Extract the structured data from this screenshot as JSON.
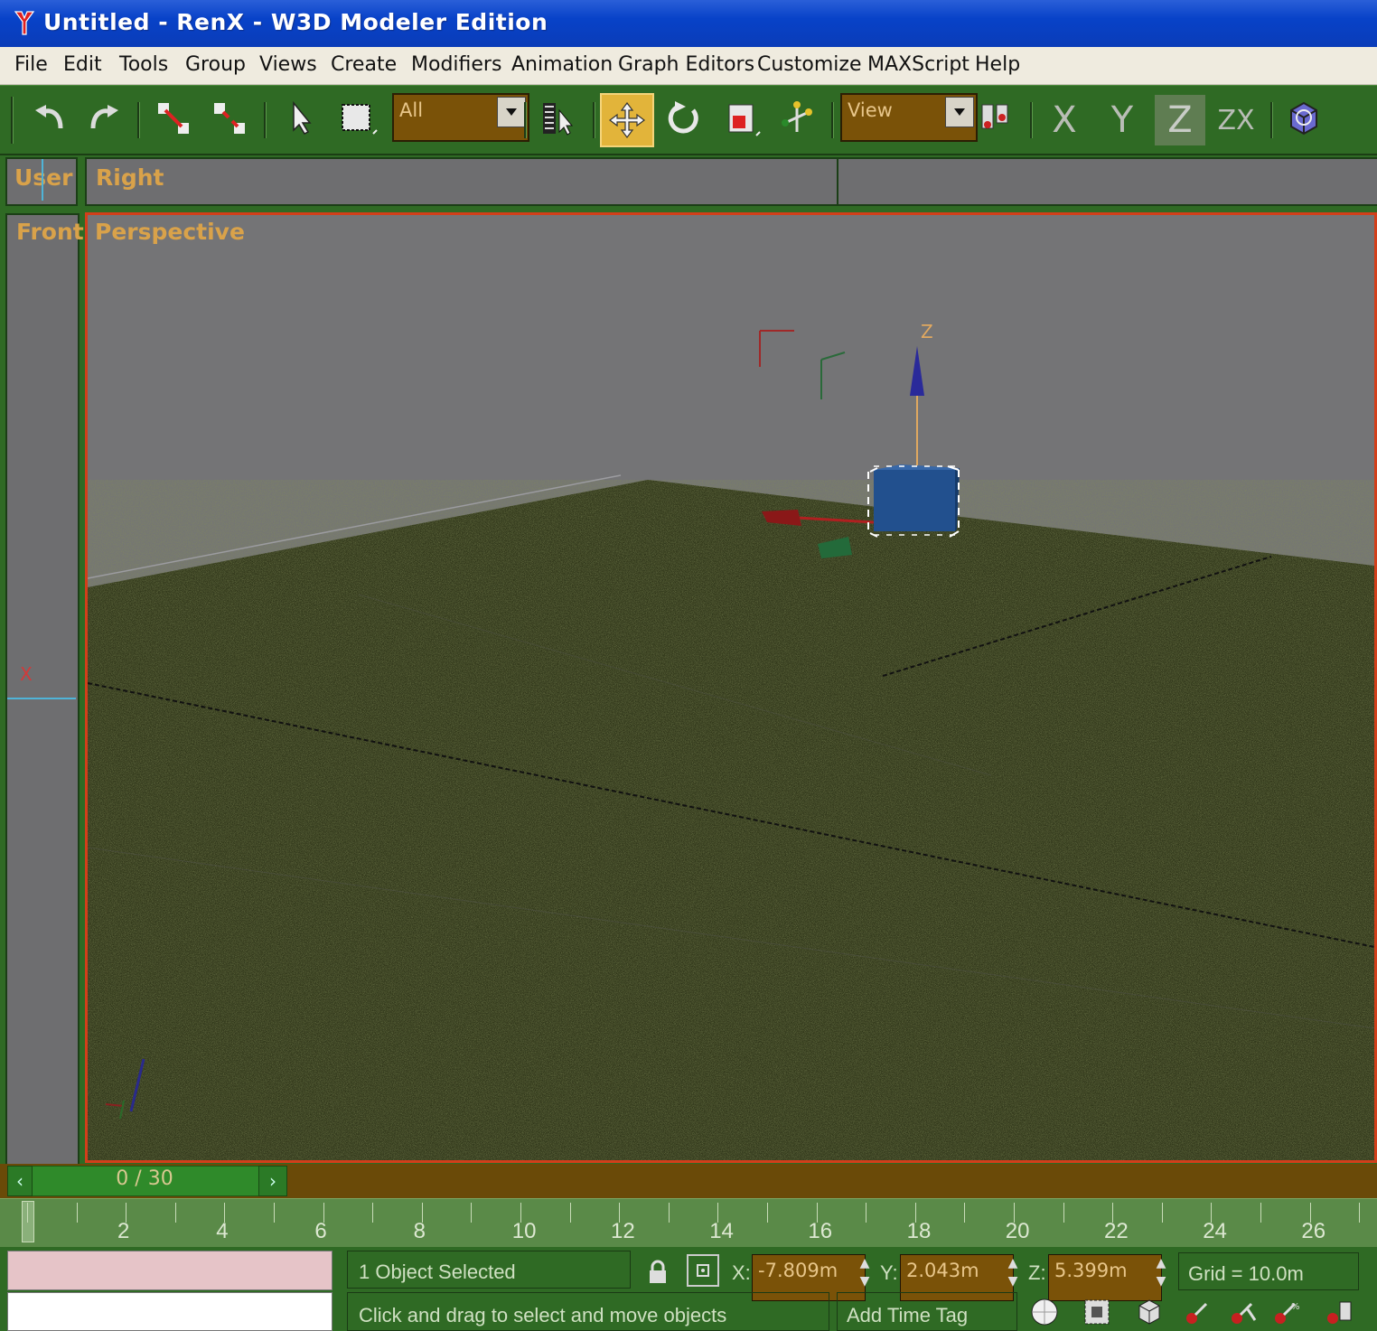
{
  "window": {
    "title": "Untitled - RenX - W3D Modeler Edition"
  },
  "menu": [
    "File",
    "Edit",
    "Tools",
    "Group",
    "Views",
    "Create",
    "Modifiers",
    "Animation",
    "Graph Editors",
    "Customize",
    "MAXScript",
    "Help"
  ],
  "toolbar": {
    "selection_filter": "All",
    "reference_coord": "View",
    "axis_constraints": {
      "x": "X",
      "y": "Y",
      "z": "Z",
      "zx": "ZX"
    },
    "active_tool": "select-and-move",
    "active_axis": "Z"
  },
  "viewports": {
    "user": "User",
    "right": "Right",
    "front": "Front",
    "perspective": "Perspective",
    "gizmo_axis_label": "Z",
    "front_axis_label": "X"
  },
  "time_slider": {
    "label": "0 / 30",
    "current_frame": 0,
    "total_frames": 30
  },
  "ruler": {
    "labels": [
      "2",
      "4",
      "6",
      "8",
      "10",
      "12",
      "14",
      "16",
      "18",
      "20",
      "22",
      "24",
      "26"
    ]
  },
  "status": {
    "selection": "1 Object Selected",
    "prompt": "Click and drag to select and move objects",
    "coords": {
      "x_label": "X:",
      "x": "-7.809m",
      "y_label": "Y:",
      "y": "2.043m",
      "z_label": "Z:",
      "z": "5.399m"
    },
    "grid": "Grid = 10.0m",
    "add_time_tag": "Add Time Tag"
  },
  "colors": {
    "title_bar": "#0842c8",
    "ui_green": "#2f6a24",
    "field_brown": "#7a5208",
    "viewport_border_active": "#d23f1a",
    "viewport_label": "#d9a24a",
    "box_object": "#234e8c"
  }
}
